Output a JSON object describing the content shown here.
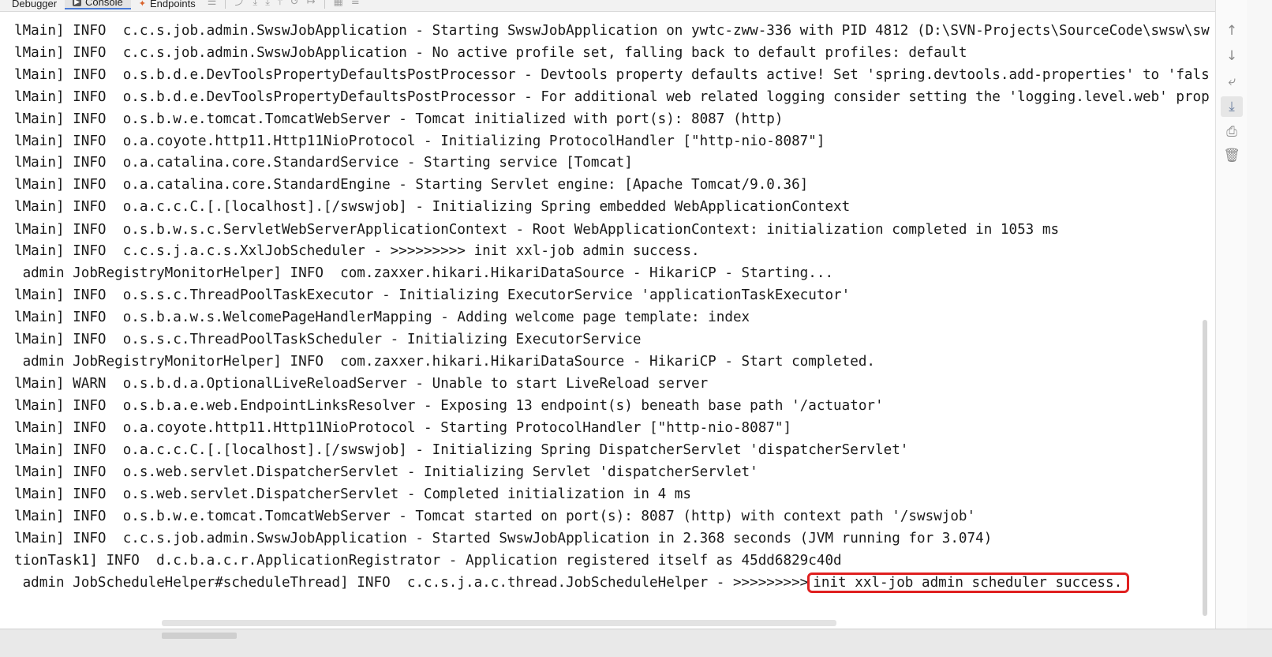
{
  "tabs": [
    {
      "label": "Debugger",
      "icon": "debugger-icon"
    },
    {
      "label": "Console",
      "icon": "console-icon",
      "active": true
    },
    {
      "label": "Endpoints",
      "icon": "endpoints-icon"
    }
  ],
  "console": {
    "lines": [
      "lMain] INFO  c.c.s.job.admin.SwswJobApplication - Starting SwswJobApplication on ywtc-zww-336 with PID 4812 (D:\\SVN-Projects\\SourceCode\\swsw\\sw",
      "lMain] INFO  c.c.s.job.admin.SwswJobApplication - No active profile set, falling back to default profiles: default",
      "lMain] INFO  o.s.b.d.e.DevToolsPropertyDefaultsPostProcessor - Devtools property defaults active! Set 'spring.devtools.add-properties' to 'fals",
      "lMain] INFO  o.s.b.d.e.DevToolsPropertyDefaultsPostProcessor - For additional web related logging consider setting the 'logging.level.web' prop",
      "lMain] INFO  o.s.b.w.e.tomcat.TomcatWebServer - Tomcat initialized with port(s): 8087 (http)",
      "lMain] INFO  o.a.coyote.http11.Http11NioProtocol - Initializing ProtocolHandler [\"http-nio-8087\"]",
      "lMain] INFO  o.a.catalina.core.StandardService - Starting service [Tomcat]",
      "lMain] INFO  o.a.catalina.core.StandardEngine - Starting Servlet engine: [Apache Tomcat/9.0.36]",
      "lMain] INFO  o.a.c.c.C.[.[localhost].[/swswjob] - Initializing Spring embedded WebApplicationContext",
      "lMain] INFO  o.s.b.w.s.c.ServletWebServerApplicationContext - Root WebApplicationContext: initialization completed in 1053 ms",
      "lMain] INFO  c.c.s.j.a.c.s.XxlJobScheduler - >>>>>>>>> init xxl-job admin success.",
      " admin JobRegistryMonitorHelper] INFO  com.zaxxer.hikari.HikariDataSource - HikariCP - Starting...",
      "lMain] INFO  o.s.s.c.ThreadPoolTaskExecutor - Initializing ExecutorService 'applicationTaskExecutor'",
      "lMain] INFO  o.s.b.a.w.s.WelcomePageHandlerMapping - Adding welcome page template: index",
      "lMain] INFO  o.s.s.c.ThreadPoolTaskScheduler - Initializing ExecutorService",
      " admin JobRegistryMonitorHelper] INFO  com.zaxxer.hikari.HikariDataSource - HikariCP - Start completed.",
      "lMain] WARN  o.s.b.d.a.OptionalLiveReloadServer - Unable to start LiveReload server",
      "lMain] INFO  o.s.b.a.e.web.EndpointLinksResolver - Exposing 13 endpoint(s) beneath base path '/actuator'",
      "lMain] INFO  o.a.coyote.http11.Http11NioProtocol - Starting ProtocolHandler [\"http-nio-8087\"]",
      "lMain] INFO  o.a.c.c.C.[.[localhost].[/swswjob] - Initializing Spring DispatcherServlet 'dispatcherServlet'",
      "lMain] INFO  o.s.web.servlet.DispatcherServlet - Initializing Servlet 'dispatcherServlet'",
      "lMain] INFO  o.s.web.servlet.DispatcherServlet - Completed initialization in 4 ms",
      "lMain] INFO  o.s.b.w.e.tomcat.TomcatWebServer - Tomcat started on port(s): 8087 (http) with context path '/swswjob'",
      "lMain] INFO  c.c.s.job.admin.SwswJobApplication - Started SwswJobApplication in 2.368 seconds (JVM running for 3.074)",
      "tionTask1] INFO  d.c.b.a.c.r.ApplicationRegistrator - Application registered itself as 45dd6829c40d"
    ],
    "last_line_prefix": " admin JobScheduleHelper#scheduleThread] INFO  c.c.s.j.a.c.thread.JobScheduleHelper - >>>>>>>>>",
    "last_line_highlight": "init xxl-job admin scheduler success.",
    "highlight_color": "#e02020"
  },
  "right_toolbar": [
    {
      "icon": "scroll-up-icon",
      "glyph": "↑"
    },
    {
      "icon": "scroll-down-icon",
      "glyph": "↓"
    },
    {
      "icon": "soft-wrap-icon",
      "glyph": "⤶"
    },
    {
      "icon": "scroll-to-end-icon",
      "glyph": "⤓",
      "active": true
    },
    {
      "icon": "print-icon",
      "glyph": "⎙"
    },
    {
      "icon": "clear-all-icon",
      "glyph": "🗑"
    }
  ]
}
